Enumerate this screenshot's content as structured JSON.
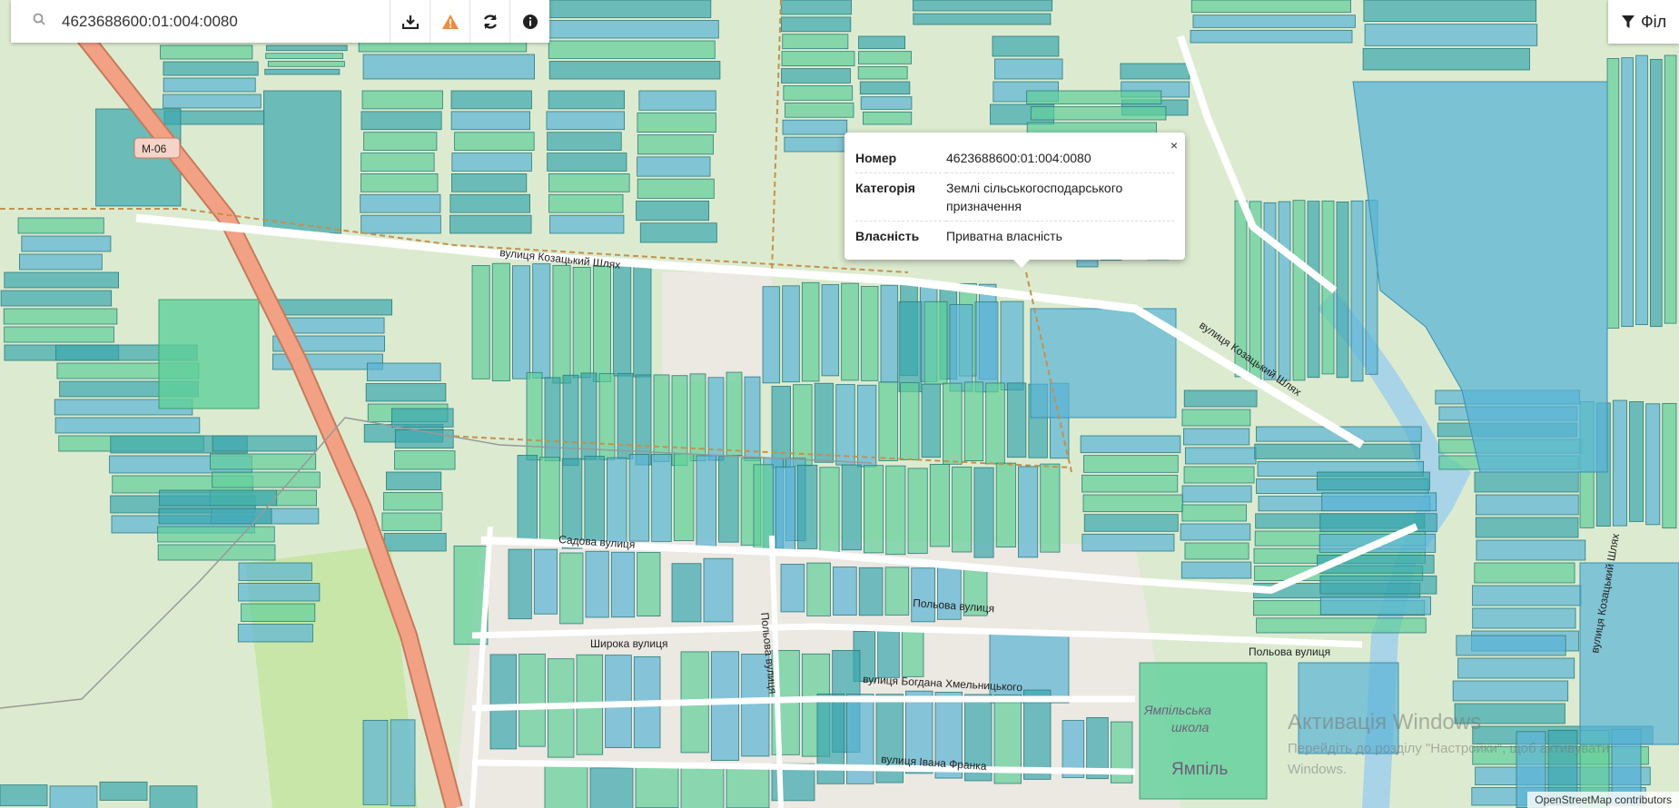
{
  "search": {
    "value": "4623688600:01:004:0080",
    "placeholder": ""
  },
  "toolbar": {
    "buttons": [
      {
        "name": "download-button",
        "icon": "download-icon"
      },
      {
        "name": "warning-button",
        "icon": "warning-icon"
      },
      {
        "name": "refresh-button",
        "icon": "refresh-icon"
      },
      {
        "name": "info-button",
        "icon": "info-icon"
      }
    ]
  },
  "filter": {
    "label": "Філ",
    "icon": "filter-icon"
  },
  "popup": {
    "close": "×",
    "rows": [
      {
        "key": "Номер",
        "value": "4623688600:01:004:0080"
      },
      {
        "key": "Категорія",
        "value": "Землі сільськогосподарського призначення"
      },
      {
        "key": "Власність",
        "value": "Приватна власність"
      }
    ]
  },
  "map_labels": {
    "road_badge": "M-06",
    "streets": [
      "вулиця Козацький Шлях",
      "вулиця Козацький Шлях",
      "Садова вулиця",
      "Польова вулиця",
      "Польова вулиця",
      "Широка вулиця",
      "Польова вулиця",
      "вулиця Богдана Хмельницького",
      "вулиця Івана Франка",
      "вулиця Козацький Шлях"
    ],
    "school": [
      "Ямпільська",
      "школа"
    ],
    "town": "Ямпіль"
  },
  "watermark": {
    "line1": "Активація Windows",
    "line2": "Перейдіть до розділу \"Настройки\", щоб активувати",
    "line3": "Windows."
  },
  "attribution": "OpenStreetMap contributors",
  "colors": {
    "parcel_green": "#5fcf9a",
    "parcel_teal": "#3aa7ae",
    "parcel_blue": "#5ab4d6",
    "road_main": "#f0a080",
    "background": "#dcebd0"
  }
}
